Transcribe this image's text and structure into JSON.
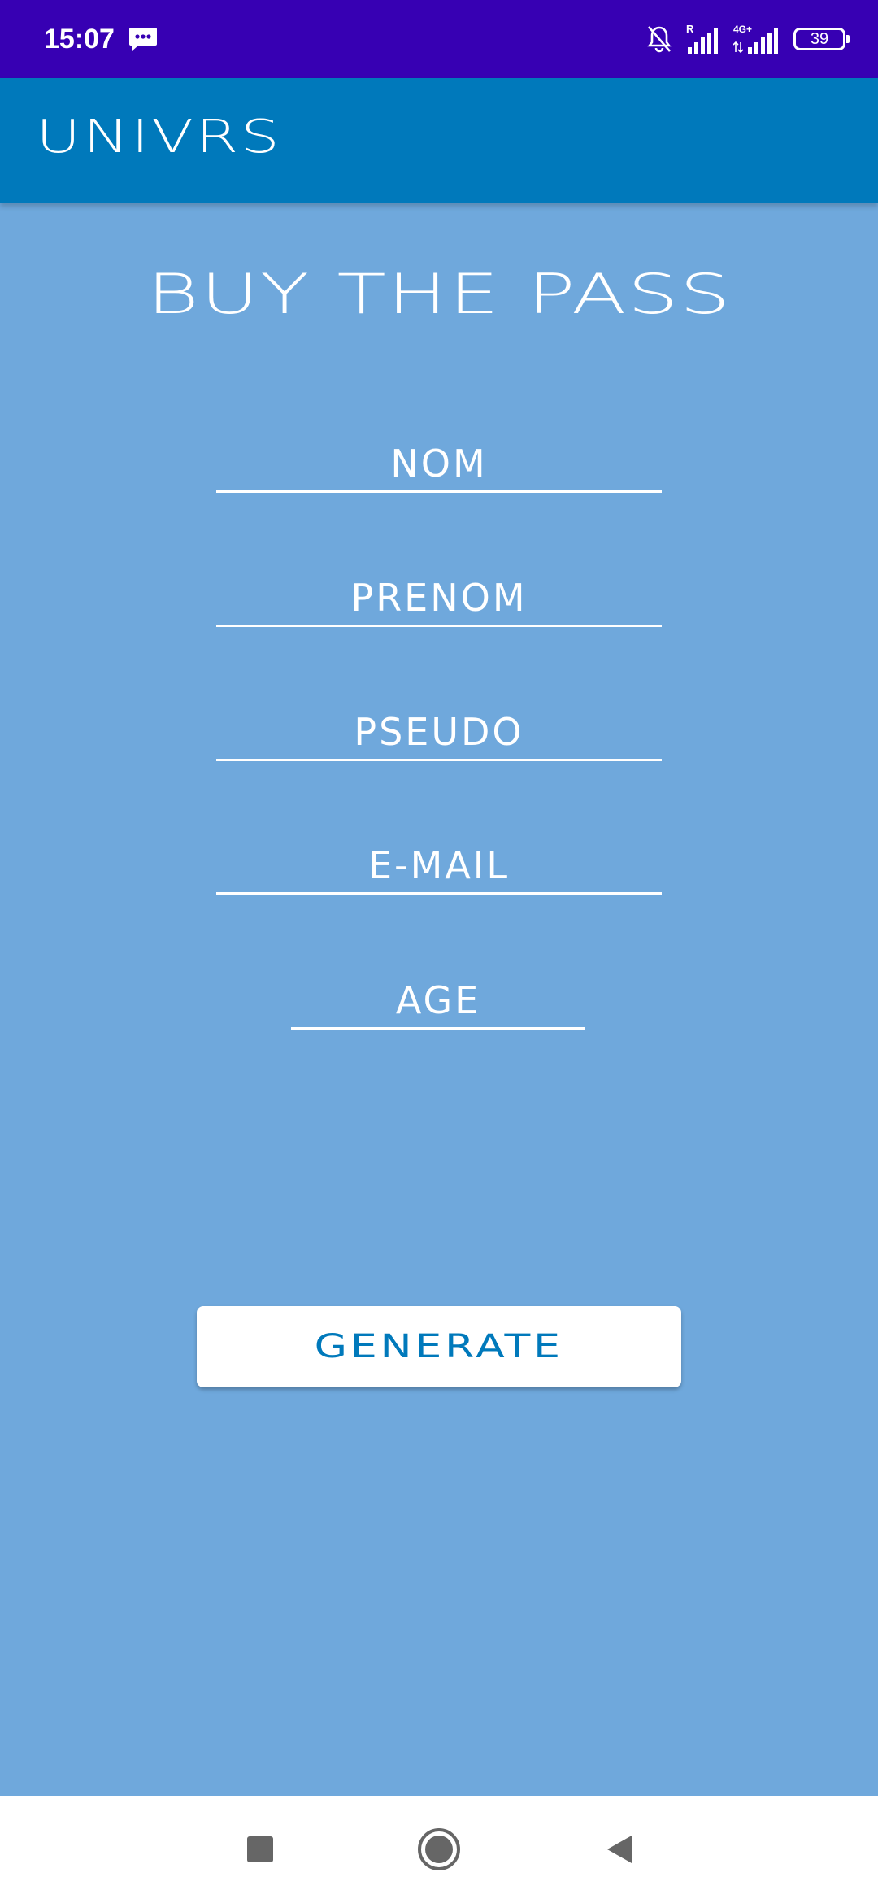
{
  "status_bar": {
    "time": "15:07",
    "battery_level": "39",
    "icons": [
      "message-icon",
      "bell-off-icon",
      "signal-roaming-icon",
      "signal-4g-icon",
      "battery-icon"
    ],
    "network_label": "4G+",
    "roaming_label": "R"
  },
  "app_bar": {
    "title": "UNIVRS"
  },
  "form": {
    "heading": "BUY THE PASS",
    "fields": {
      "nom": {
        "placeholder": "NOM",
        "value": ""
      },
      "prenom": {
        "placeholder": "PRENOM",
        "value": ""
      },
      "pseudo": {
        "placeholder": "PSEUDO",
        "value": ""
      },
      "email": {
        "placeholder": "E-MAIL",
        "value": ""
      },
      "age": {
        "placeholder": "AGE",
        "value": ""
      }
    },
    "submit_label": "GENERATE"
  },
  "nav_bar": {
    "icons": [
      "recents-square-icon",
      "home-circle-icon",
      "back-triangle-icon"
    ]
  },
  "colors": {
    "status_bar": "#3700b3",
    "app_bar": "#0079bb",
    "background": "#6fa8dc",
    "text": "#ffffff",
    "button_text": "#0079bb"
  }
}
